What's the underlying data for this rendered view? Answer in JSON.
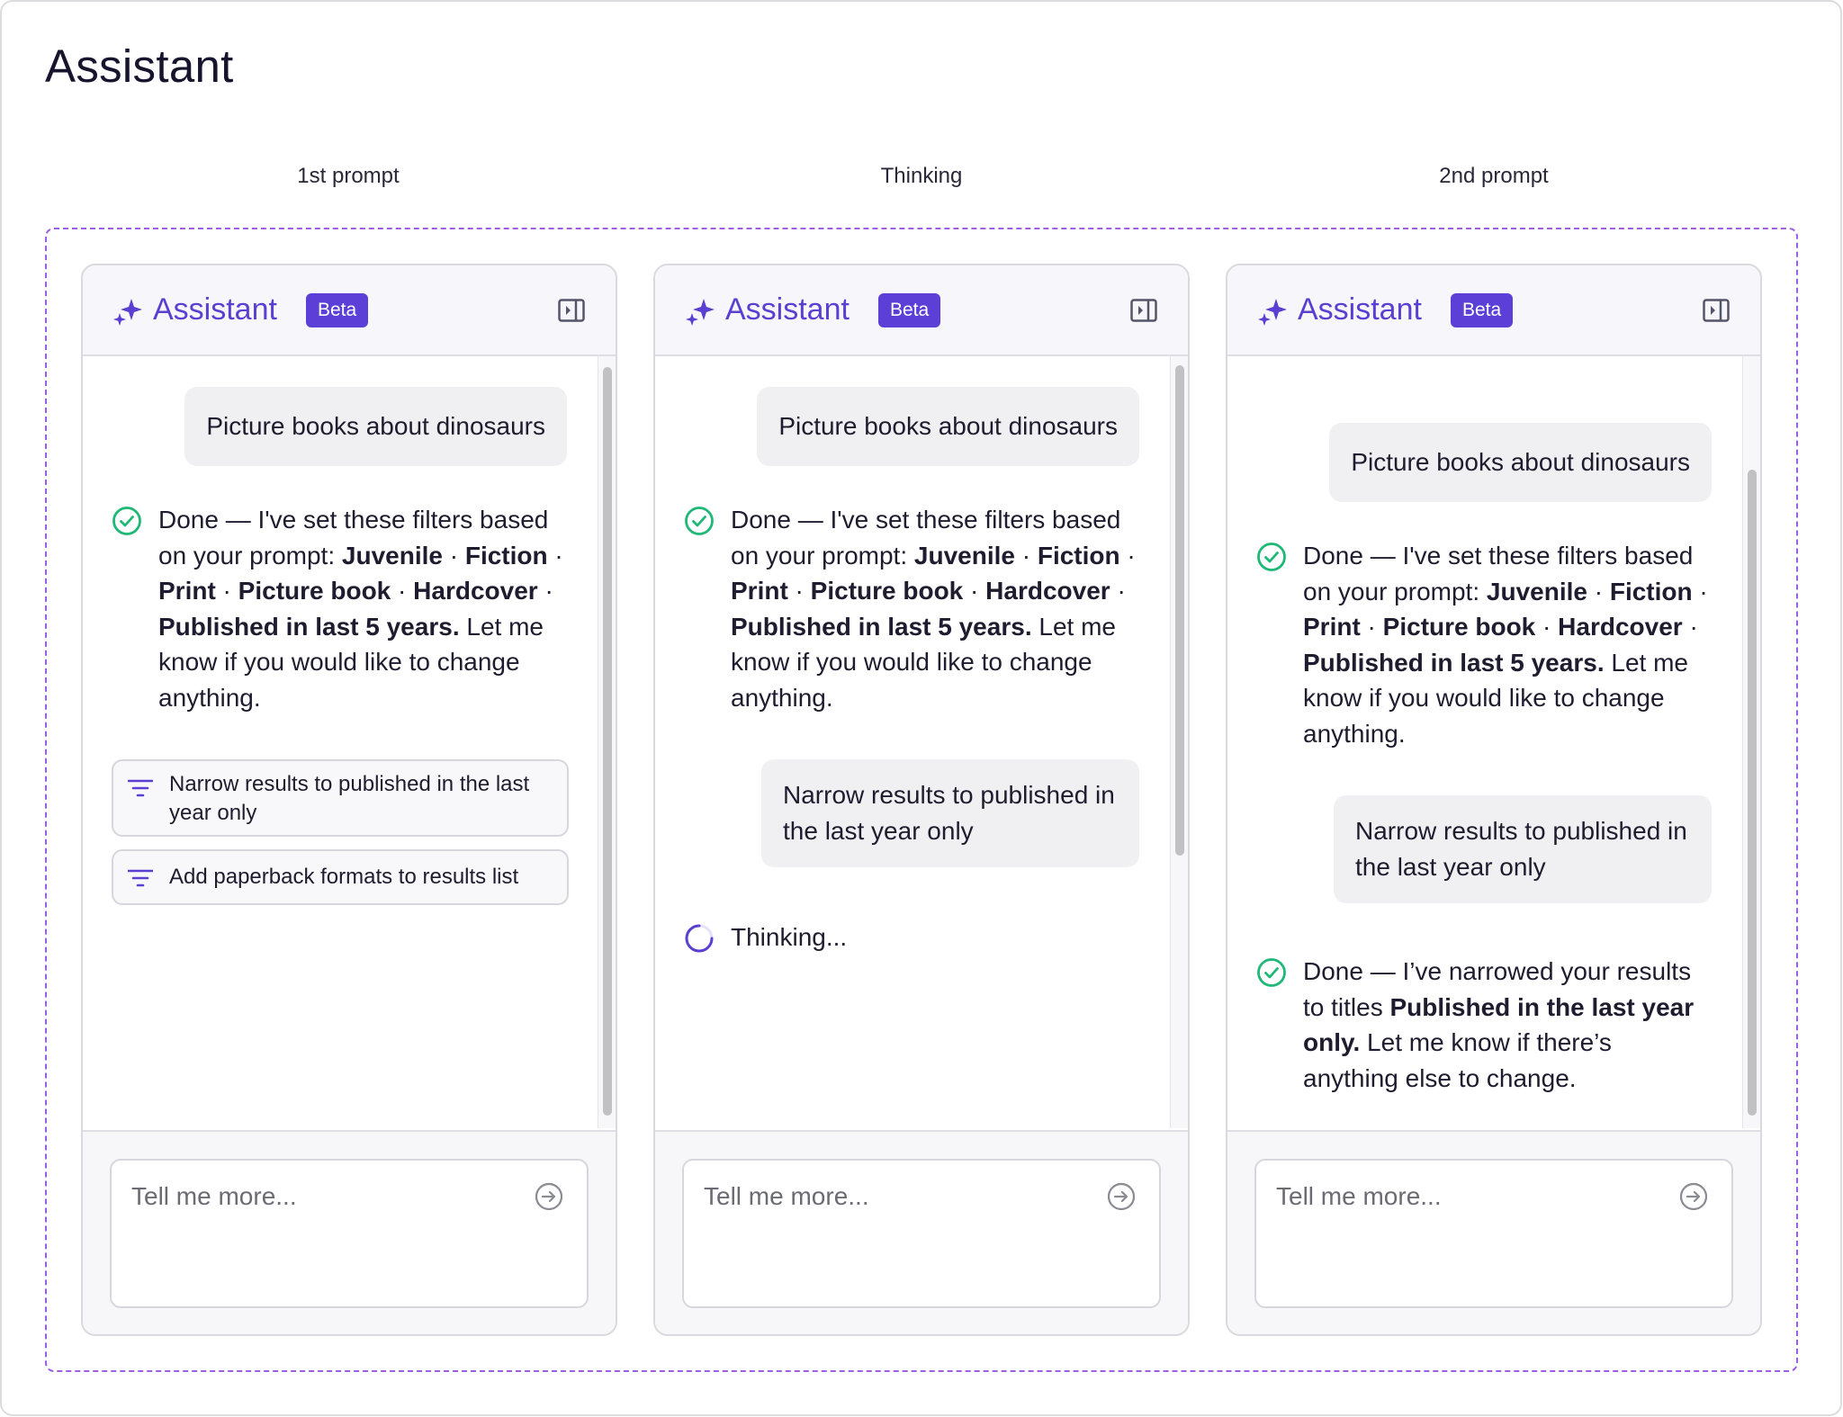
{
  "page": {
    "title": "Assistant"
  },
  "columns": [
    {
      "label": "1st prompt",
      "panel": {
        "title": "Assistant",
        "badge": "Beta",
        "messages": [
          {
            "type": "user",
            "text": "Picture books about dinosaurs"
          },
          {
            "type": "status",
            "icon": "check-circle-icon"
          }
        ],
        "suggestions": [
          {
            "icon": "filter-icon",
            "label": "Narrow results to published in the last year only"
          },
          {
            "icon": "filter-icon",
            "label": "Add paperback formats to results list"
          }
        ],
        "input": {
          "placeholder": "Tell me more..."
        }
      }
    },
    {
      "label": "Thinking",
      "panel": {
        "title": "Assistant",
        "badge": "Beta",
        "messages": [
          {
            "type": "user",
            "text": "Picture books about dinosaurs"
          },
          {
            "type": "status",
            "icon": "check-circle-icon"
          },
          {
            "type": "user",
            "text": "Narrow results to published in the last year only"
          },
          {
            "type": "thinking",
            "icon": "spinner-icon",
            "text": "Thinking..."
          }
        ],
        "input": {
          "placeholder": "Tell me more..."
        }
      }
    },
    {
      "label": "2nd prompt",
      "panel": {
        "title": "Assistant",
        "badge": "Beta",
        "messages": [
          {
            "type": "user",
            "text": "Picture books about dinosaurs"
          },
          {
            "type": "status",
            "icon": "check-circle-icon"
          },
          {
            "type": "user",
            "text": "Narrow results to published in the last year only"
          },
          {
            "type": "status",
            "icon": "check-circle-icon"
          }
        ],
        "input": {
          "placeholder": "Tell me more..."
        }
      }
    }
  ],
  "status_filters": {
    "intro": "Done — I've set these filters based on your prompt:",
    "filters": [
      "Juvenile",
      "Fiction",
      "Print",
      "Picture book",
      "Hardcover",
      "Published in last 5 years"
    ],
    "separator": " · ",
    "outro": "Let me know if you would like to change anything."
  },
  "status_narrowed": {
    "intro": "Done — I’ve narrowed your results to titles",
    "filter": "Published in the last year only",
    "outro": "Let me know if there’s anything else to change."
  },
  "colors": {
    "accent": "#5c3fd6",
    "success": "#1fb877",
    "dashed_border": "#9b5fe0"
  }
}
